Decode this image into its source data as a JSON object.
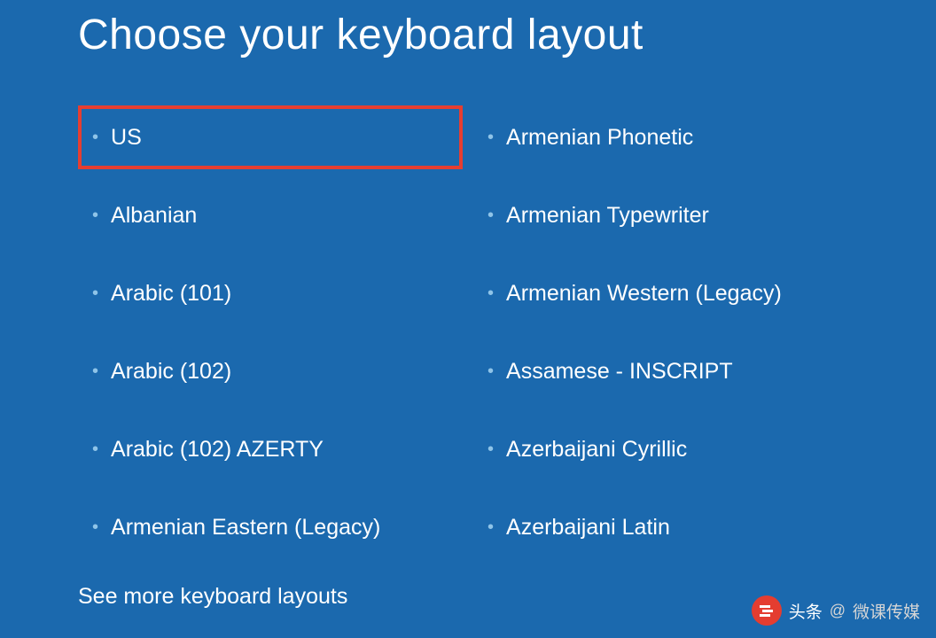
{
  "heading": "Choose your keyboard layout",
  "columns": [
    [
      "US",
      "Albanian",
      "Arabic (101)",
      "Arabic (102)",
      "Arabic (102) AZERTY",
      "Armenian Eastern (Legacy)"
    ],
    [
      "Armenian Phonetic",
      "Armenian Typewriter",
      "Armenian Western (Legacy)",
      "Assamese - INSCRIPT",
      "Azerbaijani Cyrillic",
      "Azerbaijani Latin"
    ]
  ],
  "see_more": "See more keyboard layouts",
  "highlighted_index": {
    "col": 0,
    "row": 0
  },
  "watermark": {
    "brand": "头条",
    "at": "@",
    "name": "微课传媒"
  }
}
